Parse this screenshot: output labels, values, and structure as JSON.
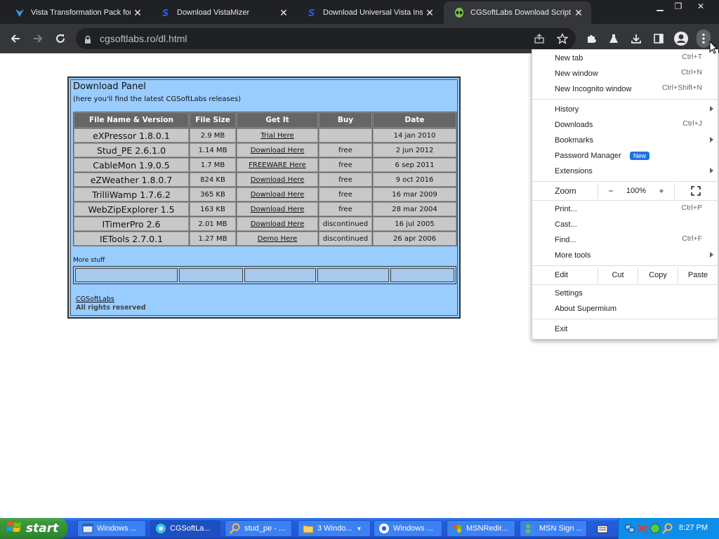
{
  "browser": {
    "tabs": [
      {
        "title": "Vista Transformation Pack for",
        "icon": "vista-pack-icon"
      },
      {
        "title": "Download VistaMizer",
        "icon": "softpedia-icon"
      },
      {
        "title": "Download Universal Vista Ins",
        "icon": "softpedia-icon"
      },
      {
        "title": "CGSoftLabs Download Script",
        "icon": "alien-icon",
        "active": true
      }
    ],
    "url": "cgsoftlabs.ro/dl.html"
  },
  "panel": {
    "title": "Download Panel",
    "subtitle": "(here you'll find the latest CGSoftLabs releases)",
    "columns": [
      "File Name & Version",
      "File Size",
      "Get It",
      "Buy",
      "Date"
    ],
    "rows": [
      {
        "name": "eXPressor 1.8.0.1",
        "size": "2.9 MB",
        "get": "Trial Here",
        "buy": "",
        "date": "14 jan 2010"
      },
      {
        "name": "Stud_PE 2.6.1.0",
        "size": "1.14 MB",
        "get": "Download Here",
        "buy": "free",
        "date": "2 jun 2012"
      },
      {
        "name": "CableMon 1.9.0.5",
        "size": "1.7 MB",
        "get": "FREEWARE Here",
        "buy": "free",
        "date": "6 sep 2011"
      },
      {
        "name": "eZWeather 1.8.0.7",
        "size": "824 KB",
        "get": "Download Here",
        "buy": "free",
        "date": "9 oct 2016"
      },
      {
        "name": "TrilliWamp 1.7.6.2",
        "size": "365 KB",
        "get": "Download Here",
        "buy": "free",
        "date": "16 mar 2009"
      },
      {
        "name": "WebZipExplorer 1.5",
        "size": "163 KB",
        "get": "Download Here",
        "buy": "free",
        "date": "28 mar 2004"
      },
      {
        "name": "ITimerPro 2.6",
        "size": "2.01 MB",
        "get": "Download Here",
        "buy": "discontinued",
        "date": "16 jul 2005"
      },
      {
        "name": "IETools 2.7.0.1",
        "size": "1.27 MB",
        "get": "Demo Here",
        "buy": "discontinued",
        "date": "26 apr 2006"
      }
    ],
    "more_label": "More stuff",
    "footer_link": "CGSoftLabs",
    "footer_text": "All rights reserved"
  },
  "menu": {
    "new_tab": "New tab",
    "new_tab_sc": "Ctrl+T",
    "new_window": "New window",
    "new_window_sc": "Ctrl+N",
    "incognito": "New Incognito window",
    "incognito_sc": "Ctrl+Shift+N",
    "history": "History",
    "downloads": "Downloads",
    "downloads_sc": "Ctrl+J",
    "bookmarks": "Bookmarks",
    "password": "Password Manager",
    "password_badge": "New",
    "extensions": "Extensions",
    "zoom": "Zoom",
    "zoom_minus": "−",
    "zoom_value": "100%",
    "zoom_plus": "+",
    "print": "Print...",
    "print_sc": "Ctrl+P",
    "cast": "Cast...",
    "find": "Find...",
    "find_sc": "Ctrl+F",
    "more_tools": "More tools",
    "edit": "Edit",
    "cut": "Cut",
    "copy": "Copy",
    "paste": "Paste",
    "settings": "Settings",
    "about": "About Supermium",
    "exit": "Exit"
  },
  "taskbar": {
    "start": "start",
    "tasks": [
      "Windows ...",
      "CGSoftLa...",
      "stud_pe - ...",
      "3 Windo...",
      "Windows ...",
      "MSNRedir...",
      "MSN Sign ..."
    ],
    "clock": "8:27 PM"
  }
}
